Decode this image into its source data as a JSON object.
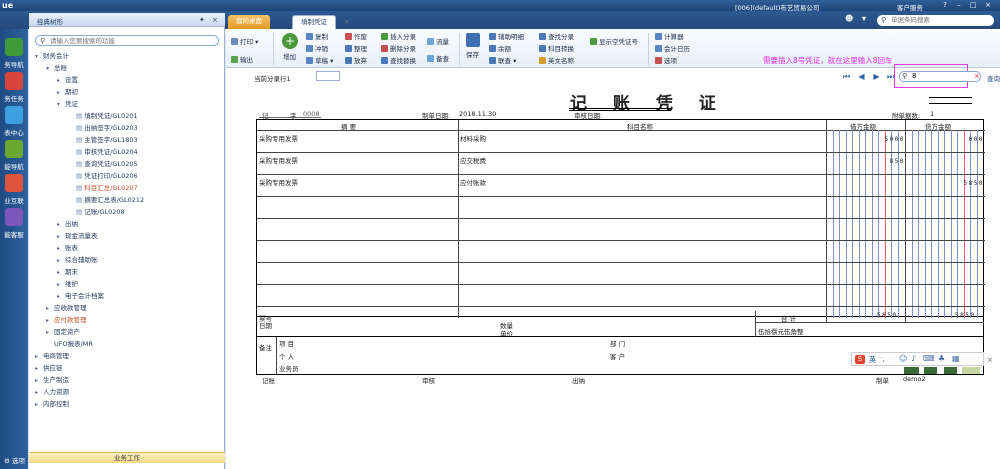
{
  "app": {
    "logo": "ue",
    "company": "[006](default)布艺贸易公司",
    "service": "客户服务",
    "search_placeholder": "单据条码搜索"
  },
  "left_strip": [
    "务导航",
    "务任务",
    "表中心",
    "能导航",
    "业互联",
    "能客服"
  ],
  "left_strip_colors": [
    "#3f9a3a",
    "#d9453a",
    "#3da0e0",
    "#6aa830",
    "#e0533d",
    "#7c56b8"
  ],
  "bottom_option": "选项",
  "tree": {
    "title": "经典树形",
    "search_placeholder": "请输入您要搜索的功能",
    "bottom_button": "业务工作",
    "nodes": [
      {
        "label": "财务会计",
        "level": 0,
        "arrow": "▾"
      },
      {
        "label": "总账",
        "level": 1,
        "arrow": "▾"
      },
      {
        "label": "设置",
        "level": 2,
        "arrow": "▸"
      },
      {
        "label": "期初",
        "level": 2,
        "arrow": "▸"
      },
      {
        "label": "凭证",
        "level": 2,
        "arrow": "▾"
      },
      {
        "label": "填制凭证/GL0201",
        "level": 3,
        "arrow": ""
      },
      {
        "label": "出纳签字/GL0203",
        "level": 3,
        "arrow": ""
      },
      {
        "label": "主管签字/GL1803",
        "level": 3,
        "arrow": ""
      },
      {
        "label": "审核凭证/GL0204",
        "level": 3,
        "arrow": ""
      },
      {
        "label": "查询凭证/GL0205",
        "level": 3,
        "arrow": ""
      },
      {
        "label": "凭证打印/GL0206",
        "level": 3,
        "arrow": ""
      },
      {
        "label": "科目汇总/GL0207",
        "level": 3,
        "arrow": "",
        "red": true
      },
      {
        "label": "摘要汇总表/GL0212",
        "level": 3,
        "arrow": ""
      },
      {
        "label": "记账/GL0208",
        "level": 3,
        "arrow": ""
      },
      {
        "label": "出纳",
        "level": 2,
        "arrow": "▸"
      },
      {
        "label": "现金流量表",
        "level": 2,
        "arrow": "▸"
      },
      {
        "label": "账表",
        "level": 2,
        "arrow": "▸"
      },
      {
        "label": "综合辅助账",
        "level": 2,
        "arrow": "▸"
      },
      {
        "label": "期末",
        "level": 2,
        "arrow": "▸"
      },
      {
        "label": "维护",
        "level": 2,
        "arrow": "▸"
      },
      {
        "label": "电子会计档案",
        "level": 2,
        "arrow": "▸"
      },
      {
        "label": "应收款管理",
        "level": 1,
        "arrow": "▸"
      },
      {
        "label": "应付款管理",
        "level": 1,
        "arrow": "▸",
        "red": true
      },
      {
        "label": "固定资产",
        "level": 1,
        "arrow": "▸"
      },
      {
        "label": "UFO报表/MR",
        "level": 1,
        "arrow": ""
      },
      {
        "label": "电商管理",
        "level": 0,
        "arrow": "▸"
      },
      {
        "label": "供应链",
        "level": 0,
        "arrow": "▸"
      },
      {
        "label": "生产制造",
        "level": 0,
        "arrow": "▸"
      },
      {
        "label": "人力资源",
        "level": 0,
        "arrow": "▸"
      },
      {
        "label": "内部控制",
        "level": 0,
        "arrow": "▸"
      }
    ]
  },
  "tabs": {
    "desk": "我的桌面",
    "voucher": "填制凭证"
  },
  "toolbar": {
    "print": "打印",
    "output": "输出",
    "add": "增加",
    "copy": "复制",
    "reverse": "冲销",
    "draft": "草稿",
    "void": "作废",
    "tidy": "整理",
    "abandon": "放弃",
    "insert": "插入分录",
    "delete": "删除分录",
    "findreplace": "查找替换",
    "flow": "流量",
    "spare": "备查",
    "save": "保存",
    "aux": "辅助明细",
    "balance": "余额",
    "linked": "联查",
    "findentry": "查找分录",
    "subjconv": "科目转换",
    "english": "英文名称",
    "showvoid": "显示空凭证号",
    "calc": "计算器",
    "calendar": "会计日历",
    "options": "选项"
  },
  "annotation": "需要插入8号凭证，就在这里输入8回车",
  "voucher_search": {
    "value": "8",
    "query": "查询"
  },
  "voucher": {
    "title": "记 账 凭 证",
    "current_row": "当前分录行1",
    "record_label": "记",
    "number_label": "字",
    "number": "0008",
    "date_label": "制单日期:",
    "date": "2018.11.30",
    "audit_label": "审核日期:",
    "attach_label": "附单据数:",
    "attach": "1",
    "col_summary": "摘 要",
    "col_subject": "科目名称",
    "col_debit": "借方金额",
    "col_credit": "贷方金额",
    "rows": [
      {
        "summary": "采购专用发票",
        "subject": "材料采购",
        "debit": "5000",
        "credit": "000"
      },
      {
        "summary": "采购专用发票",
        "subject": "应交税费",
        "debit": "850",
        "credit": ""
      },
      {
        "summary": "采购专用发票",
        "subject": "应付账款",
        "debit": "",
        "credit": "5850"
      }
    ],
    "ticket": "票号",
    "day": "日期",
    "qty": "数量",
    "price": "单价",
    "total_label": "合 计",
    "total_debit": "5850",
    "total_credit": "5850",
    "total_words": "伍拾捌元伍角整",
    "remark": "备注",
    "project": "项 目",
    "person": "个 人",
    "salesman": "业务员",
    "dept": "部 门",
    "customer": "客 户",
    "bookkeep": "记账",
    "review": "审核",
    "cashier": "出纳",
    "maker_label": "制单",
    "maker": "demo2"
  },
  "ime": "英"
}
